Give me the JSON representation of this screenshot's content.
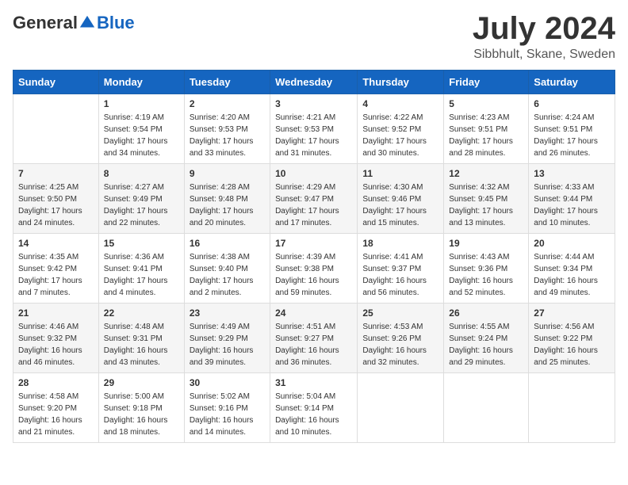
{
  "header": {
    "logo_general": "General",
    "logo_blue": "Blue",
    "month_year": "July 2024",
    "location": "Sibbhult, Skane, Sweden"
  },
  "days_of_week": [
    "Sunday",
    "Monday",
    "Tuesday",
    "Wednesday",
    "Thursday",
    "Friday",
    "Saturday"
  ],
  "weeks": [
    [
      {
        "day": "",
        "sunrise": "",
        "sunset": "",
        "daylight": ""
      },
      {
        "day": "1",
        "sunrise": "Sunrise: 4:19 AM",
        "sunset": "Sunset: 9:54 PM",
        "daylight": "Daylight: 17 hours and 34 minutes."
      },
      {
        "day": "2",
        "sunrise": "Sunrise: 4:20 AM",
        "sunset": "Sunset: 9:53 PM",
        "daylight": "Daylight: 17 hours and 33 minutes."
      },
      {
        "day": "3",
        "sunrise": "Sunrise: 4:21 AM",
        "sunset": "Sunset: 9:53 PM",
        "daylight": "Daylight: 17 hours and 31 minutes."
      },
      {
        "day": "4",
        "sunrise": "Sunrise: 4:22 AM",
        "sunset": "Sunset: 9:52 PM",
        "daylight": "Daylight: 17 hours and 30 minutes."
      },
      {
        "day": "5",
        "sunrise": "Sunrise: 4:23 AM",
        "sunset": "Sunset: 9:51 PM",
        "daylight": "Daylight: 17 hours and 28 minutes."
      },
      {
        "day": "6",
        "sunrise": "Sunrise: 4:24 AM",
        "sunset": "Sunset: 9:51 PM",
        "daylight": "Daylight: 17 hours and 26 minutes."
      }
    ],
    [
      {
        "day": "7",
        "sunrise": "Sunrise: 4:25 AM",
        "sunset": "Sunset: 9:50 PM",
        "daylight": "Daylight: 17 hours and 24 minutes."
      },
      {
        "day": "8",
        "sunrise": "Sunrise: 4:27 AM",
        "sunset": "Sunset: 9:49 PM",
        "daylight": "Daylight: 17 hours and 22 minutes."
      },
      {
        "day": "9",
        "sunrise": "Sunrise: 4:28 AM",
        "sunset": "Sunset: 9:48 PM",
        "daylight": "Daylight: 17 hours and 20 minutes."
      },
      {
        "day": "10",
        "sunrise": "Sunrise: 4:29 AM",
        "sunset": "Sunset: 9:47 PM",
        "daylight": "Daylight: 17 hours and 17 minutes."
      },
      {
        "day": "11",
        "sunrise": "Sunrise: 4:30 AM",
        "sunset": "Sunset: 9:46 PM",
        "daylight": "Daylight: 17 hours and 15 minutes."
      },
      {
        "day": "12",
        "sunrise": "Sunrise: 4:32 AM",
        "sunset": "Sunset: 9:45 PM",
        "daylight": "Daylight: 17 hours and 13 minutes."
      },
      {
        "day": "13",
        "sunrise": "Sunrise: 4:33 AM",
        "sunset": "Sunset: 9:44 PM",
        "daylight": "Daylight: 17 hours and 10 minutes."
      }
    ],
    [
      {
        "day": "14",
        "sunrise": "Sunrise: 4:35 AM",
        "sunset": "Sunset: 9:42 PM",
        "daylight": "Daylight: 17 hours and 7 minutes."
      },
      {
        "day": "15",
        "sunrise": "Sunrise: 4:36 AM",
        "sunset": "Sunset: 9:41 PM",
        "daylight": "Daylight: 17 hours and 4 minutes."
      },
      {
        "day": "16",
        "sunrise": "Sunrise: 4:38 AM",
        "sunset": "Sunset: 9:40 PM",
        "daylight": "Daylight: 17 hours and 2 minutes."
      },
      {
        "day": "17",
        "sunrise": "Sunrise: 4:39 AM",
        "sunset": "Sunset: 9:38 PM",
        "daylight": "Daylight: 16 hours and 59 minutes."
      },
      {
        "day": "18",
        "sunrise": "Sunrise: 4:41 AM",
        "sunset": "Sunset: 9:37 PM",
        "daylight": "Daylight: 16 hours and 56 minutes."
      },
      {
        "day": "19",
        "sunrise": "Sunrise: 4:43 AM",
        "sunset": "Sunset: 9:36 PM",
        "daylight": "Daylight: 16 hours and 52 minutes."
      },
      {
        "day": "20",
        "sunrise": "Sunrise: 4:44 AM",
        "sunset": "Sunset: 9:34 PM",
        "daylight": "Daylight: 16 hours and 49 minutes."
      }
    ],
    [
      {
        "day": "21",
        "sunrise": "Sunrise: 4:46 AM",
        "sunset": "Sunset: 9:32 PM",
        "daylight": "Daylight: 16 hours and 46 minutes."
      },
      {
        "day": "22",
        "sunrise": "Sunrise: 4:48 AM",
        "sunset": "Sunset: 9:31 PM",
        "daylight": "Daylight: 16 hours and 43 minutes."
      },
      {
        "day": "23",
        "sunrise": "Sunrise: 4:49 AM",
        "sunset": "Sunset: 9:29 PM",
        "daylight": "Daylight: 16 hours and 39 minutes."
      },
      {
        "day": "24",
        "sunrise": "Sunrise: 4:51 AM",
        "sunset": "Sunset: 9:27 PM",
        "daylight": "Daylight: 16 hours and 36 minutes."
      },
      {
        "day": "25",
        "sunrise": "Sunrise: 4:53 AM",
        "sunset": "Sunset: 9:26 PM",
        "daylight": "Daylight: 16 hours and 32 minutes."
      },
      {
        "day": "26",
        "sunrise": "Sunrise: 4:55 AM",
        "sunset": "Sunset: 9:24 PM",
        "daylight": "Daylight: 16 hours and 29 minutes."
      },
      {
        "day": "27",
        "sunrise": "Sunrise: 4:56 AM",
        "sunset": "Sunset: 9:22 PM",
        "daylight": "Daylight: 16 hours and 25 minutes."
      }
    ],
    [
      {
        "day": "28",
        "sunrise": "Sunrise: 4:58 AM",
        "sunset": "Sunset: 9:20 PM",
        "daylight": "Daylight: 16 hours and 21 minutes."
      },
      {
        "day": "29",
        "sunrise": "Sunrise: 5:00 AM",
        "sunset": "Sunset: 9:18 PM",
        "daylight": "Daylight: 16 hours and 18 minutes."
      },
      {
        "day": "30",
        "sunrise": "Sunrise: 5:02 AM",
        "sunset": "Sunset: 9:16 PM",
        "daylight": "Daylight: 16 hours and 14 minutes."
      },
      {
        "day": "31",
        "sunrise": "Sunrise: 5:04 AM",
        "sunset": "Sunset: 9:14 PM",
        "daylight": "Daylight: 16 hours and 10 minutes."
      },
      {
        "day": "",
        "sunrise": "",
        "sunset": "",
        "daylight": ""
      },
      {
        "day": "",
        "sunrise": "",
        "sunset": "",
        "daylight": ""
      },
      {
        "day": "",
        "sunrise": "",
        "sunset": "",
        "daylight": ""
      }
    ]
  ]
}
